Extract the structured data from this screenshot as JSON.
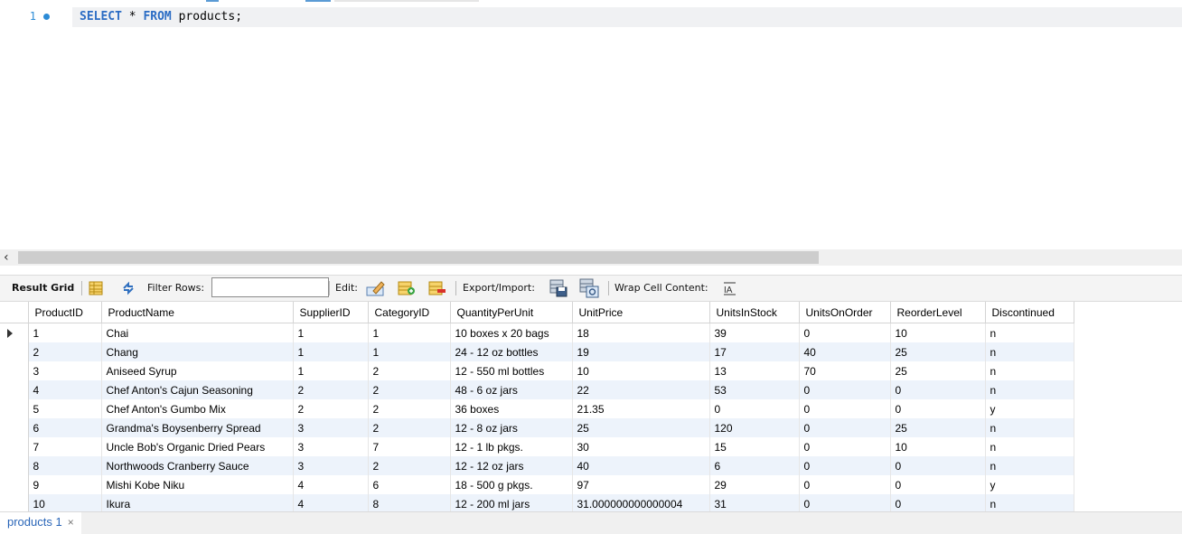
{
  "editor": {
    "line_number": "1",
    "query_parts": [
      "SELECT",
      " * ",
      "FROM",
      " products;"
    ]
  },
  "toolbar": {
    "result_grid": "Result Grid",
    "filter_rows": "Filter Rows:",
    "filter_value": "",
    "edit": "Edit:",
    "export_import": "Export/Import:",
    "wrap_cell_content": "Wrap Cell Content:",
    "icons": [
      "grid-form-icon",
      "refresh-icon",
      "edit-row-icon",
      "add-row-icon",
      "delete-row-icon",
      "export-icon",
      "import-icon",
      "wrap-text-icon"
    ]
  },
  "grid": {
    "columns": [
      "ProductID",
      "ProductName",
      "SupplierID",
      "CategoryID",
      "QuantityPerUnit",
      "UnitPrice",
      "UnitsInStock",
      "UnitsOnOrder",
      "ReorderLevel",
      "Discontinued"
    ],
    "rows": [
      [
        "1",
        "Chai",
        "1",
        "1",
        "10 boxes x 20 bags",
        "18",
        "39",
        "0",
        "10",
        "n"
      ],
      [
        "2",
        "Chang",
        "1",
        "1",
        "24 - 12 oz bottles",
        "19",
        "17",
        "40",
        "25",
        "n"
      ],
      [
        "3",
        "Aniseed Syrup",
        "1",
        "2",
        "12 - 550 ml bottles",
        "10",
        "13",
        "70",
        "25",
        "n"
      ],
      [
        "4",
        "Chef Anton's Cajun Seasoning",
        "2",
        "2",
        "48 - 6 oz jars",
        "22",
        "53",
        "0",
        "0",
        "n"
      ],
      [
        "5",
        "Chef Anton's Gumbo Mix",
        "2",
        "2",
        "36 boxes",
        "21.35",
        "0",
        "0",
        "0",
        "y"
      ],
      [
        "6",
        "Grandma's Boysenberry Spread",
        "3",
        "2",
        "12 - 8 oz jars",
        "25",
        "120",
        "0",
        "25",
        "n"
      ],
      [
        "7",
        "Uncle Bob's Organic Dried Pears",
        "3",
        "7",
        "12 - 1 lb pkgs.",
        "30",
        "15",
        "0",
        "10",
        "n"
      ],
      [
        "8",
        "Northwoods Cranberry Sauce",
        "3",
        "2",
        "12 - 12 oz jars",
        "40",
        "6",
        "0",
        "0",
        "n"
      ],
      [
        "9",
        "Mishi Kobe Niku",
        "4",
        "6",
        "18 - 500 g pkgs.",
        "97",
        "29",
        "0",
        "0",
        "y"
      ],
      [
        "10",
        "Ikura",
        "4",
        "8",
        "12 - 200 ml jars",
        "31.000000000000004",
        "31",
        "0",
        "0",
        "n"
      ]
    ],
    "selected_row": 0
  },
  "tabs": [
    {
      "label": "products 1",
      "close": "×"
    }
  ],
  "colors": {
    "keyword": "#2b6cc4",
    "alt_row": "#edf3fb",
    "tab_text": "#2a66b8"
  }
}
